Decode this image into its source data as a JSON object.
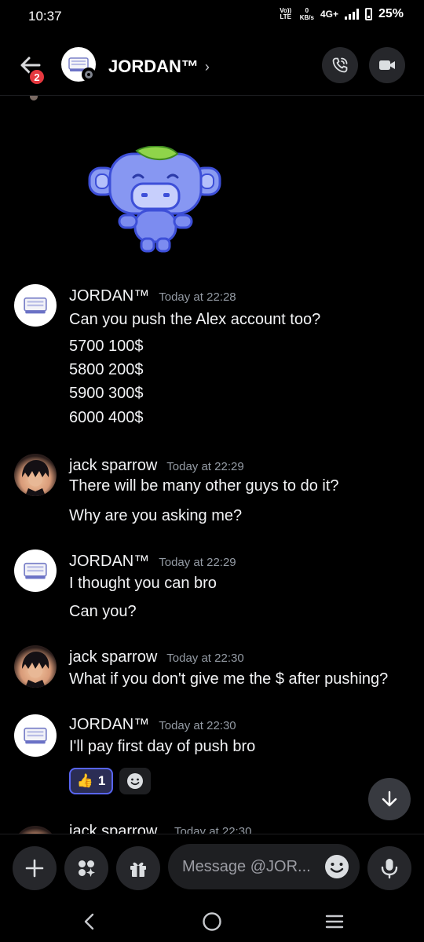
{
  "status_bar": {
    "time": "10:37",
    "volte": "Vo)) LTE",
    "speed_value": "0",
    "speed_unit": "KB/s",
    "network": "4G+",
    "battery": "25%"
  },
  "header": {
    "title": "JORDAN™",
    "chevron": "›",
    "badge_count": "2",
    "buttons": [
      "phone-call-icon",
      "video-call-icon"
    ]
  },
  "messages": [
    {
      "author": "JORDAN™",
      "time": "Today at 22:28",
      "lines": [
        "Can you push the Alex account too?",
        "5700 100$",
        "5800 200$",
        "5900 300$",
        "6000 400$"
      ]
    },
    {
      "author": "jack sparrow",
      "time": "Today at 22:29",
      "lines": [
        "There will be many other guys to do it?",
        "Why are you asking me?"
      ]
    },
    {
      "author": "JORDAN™",
      "time": "Today at 22:29",
      "lines": [
        "I thought you can bro",
        "Can you?"
      ]
    },
    {
      "author": "jack sparrow",
      "time": "Today at 22:30",
      "lines": [
        "What if you don't give me the $ after pushing?"
      ]
    },
    {
      "author": "JORDAN™",
      "time": "Today at 22:30",
      "lines": [
        "I'll pay first day of push bro"
      ],
      "reactions": [
        {
          "emoji": "👍",
          "count": "1"
        }
      ]
    },
    {
      "author": "jack sparrow",
      "time": "Today at 22:30",
      "lines": []
    }
  ],
  "composer": {
    "placeholder": "Message @JOR...",
    "icons": [
      "plus-icon",
      "apps-icon",
      "gift-icon",
      "emoji-icon",
      "microphone-icon"
    ]
  },
  "colors": {
    "background": "#000000",
    "accent": "#5865f2",
    "muted_text": "#949ba4",
    "badge": "#e5383f"
  }
}
